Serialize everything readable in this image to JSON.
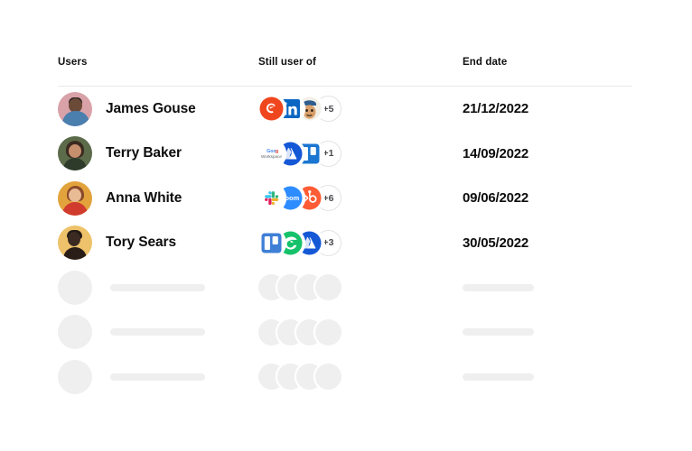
{
  "table": {
    "columns": [
      {
        "key": "users",
        "label": "Users"
      },
      {
        "key": "apps",
        "label": "Still user of"
      },
      {
        "key": "date",
        "label": "End date"
      }
    ],
    "rows": [
      {
        "name": "James Gouse",
        "avatar": "avatar-james-gouse",
        "apps": [
          {
            "icon": "ecwid-icon",
            "label": "Ecwid"
          },
          {
            "icon": "linkedin-icon",
            "label": "LinkedIn"
          },
          {
            "icon": "mailchimp-icon",
            "label": "Mailchimp"
          }
        ],
        "more": "+5",
        "end_date": "21/12/2022"
      },
      {
        "name": "Terry Baker",
        "avatar": "avatar-terry-baker",
        "apps": [
          {
            "icon": "google-workspace-icon",
            "label": "Google Workspace"
          },
          {
            "icon": "atlassian-icon",
            "label": "Atlassian"
          },
          {
            "icon": "trello-icon",
            "label": "Trello"
          }
        ],
        "more": "+1",
        "end_date": "14/09/2022"
      },
      {
        "name": "Anna White",
        "avatar": "avatar-anna-white",
        "apps": [
          {
            "icon": "slack-icon",
            "label": "Slack"
          },
          {
            "icon": "zoom-icon",
            "label": "Zoom"
          },
          {
            "icon": "hubspot-icon",
            "label": "HubSpot"
          }
        ],
        "more": "+6",
        "end_date": "09/06/2022"
      },
      {
        "name": "Tory Sears",
        "avatar": "avatar-tory-sears",
        "apps": [
          {
            "icon": "trello-icon",
            "label": "Trello"
          },
          {
            "icon": "grammarly-icon",
            "label": "Grammarly"
          },
          {
            "icon": "atlassian-icon",
            "label": "Atlassian"
          }
        ],
        "more": "+3",
        "end_date": "30/05/2022"
      }
    ],
    "skeleton_rows": 3
  },
  "colors": {
    "text_primary": "#0d0d0d",
    "divider": "#e9e9ea",
    "skeleton": "#efefef",
    "badge_border": "#e3e3e5",
    "badge_text": "#4a4a4f",
    "background": "#ffffff"
  }
}
